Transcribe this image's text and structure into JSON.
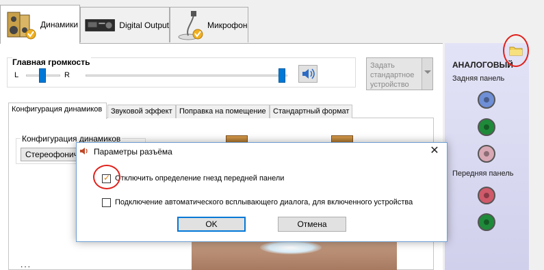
{
  "device_tabs": [
    {
      "label": "Динамики",
      "icon": "speakers-icon",
      "active": true
    },
    {
      "label": "Digital Output",
      "icon": "receiver-icon",
      "active": false
    },
    {
      "label": "Микрофон",
      "icon": "microphone-icon",
      "active": false
    }
  ],
  "volume": {
    "title": "Главная громкость",
    "left_label": "L",
    "right_label": "R",
    "balance_fraction": 0.5,
    "level_fraction": 1.0,
    "mute_icon": "speaker-volume-icon"
  },
  "default_device_button": {
    "label": "Задать стандартное устройство",
    "enabled": false
  },
  "inner_tabs": [
    {
      "label": "Конфигурация динамиков",
      "active": true
    },
    {
      "label": "Звуковой эффект",
      "active": false
    },
    {
      "label": "Поправка на помещение",
      "active": false
    },
    {
      "label": "Стандартный формат",
      "active": false
    }
  ],
  "speaker_config": {
    "group_title": "Конфигурация динамиков",
    "selected": "Стереофонический"
  },
  "bottom_dots": "...",
  "jack_panel": {
    "heading": "АНАЛОГОВЫЙ",
    "rear_label": "Задняя панель",
    "front_label": "Передняя панель",
    "folder_icon": "folder-icon",
    "rear_jacks": [
      "#6f8fd6",
      "#1f8a3a",
      "#d8a8b4"
    ],
    "front_jacks": [
      "#d05a6a",
      "#1f8a3a"
    ]
  },
  "dialog": {
    "title": "Параметры разъёма",
    "icon": "speaker-icon",
    "option1": {
      "label": "Отключить определение гнезд передней панели",
      "checked": true
    },
    "option2": {
      "label": "Подключение автоматического всплывающего диалога, для включенного устройства",
      "checked": false
    },
    "ok_label": "OK",
    "cancel_label": "Отмена"
  },
  "colors": {
    "accent": "#0078d7",
    "annotation_red": "#e0201a"
  }
}
